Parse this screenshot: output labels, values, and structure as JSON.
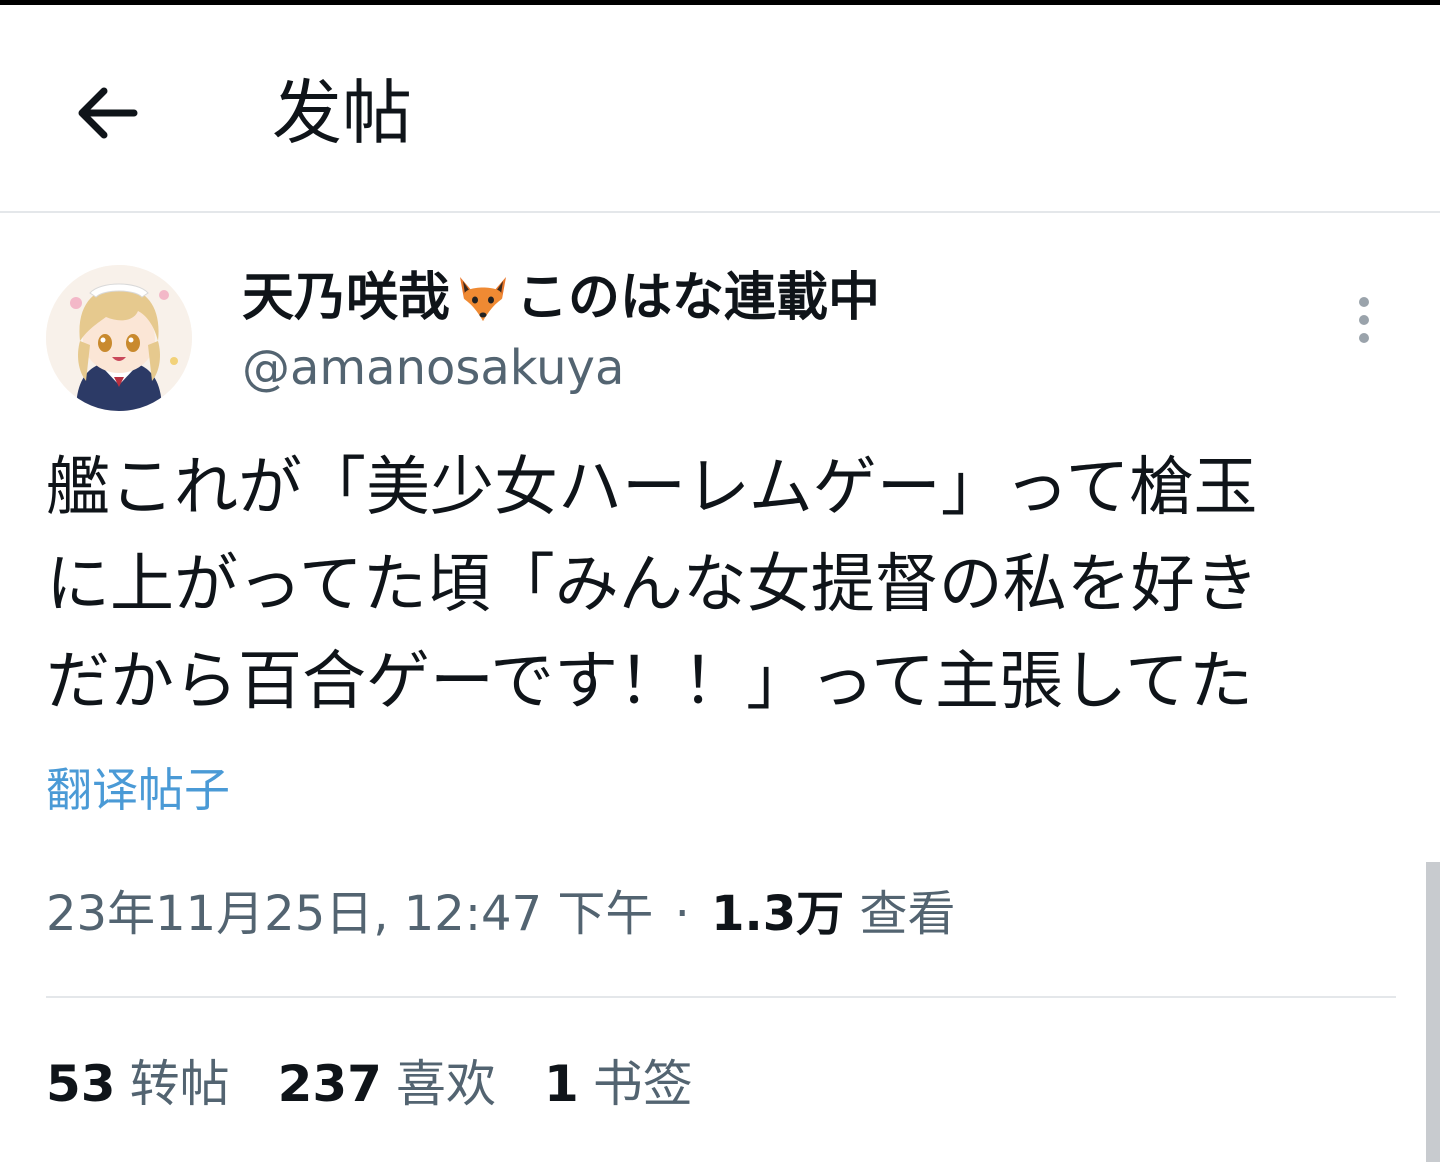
{
  "header": {
    "title": "发帖",
    "back_icon": "arrow-left-icon"
  },
  "author": {
    "name_part1": "天乃咲哉",
    "emoji": "fox-icon",
    "name_part2": "このはな連載中",
    "handle": "@amanosakuya"
  },
  "tweet": {
    "lines": [
      "艦これが「美少女ハーレムゲー」って槍玉",
      "に上がってた頃「みんな女提督の私を好き",
      "だから百合ゲーです！！」って主張してた"
    ]
  },
  "translate_label": "翻译帖子",
  "meta": {
    "timestamp": "23年11月25日, 12:47 下午",
    "separator": "·",
    "views_count": "1.3万",
    "views_label": "查看"
  },
  "stats": {
    "reposts_count": "53",
    "reposts_label": "转帖",
    "likes_count": "237",
    "likes_label": "喜欢",
    "bookmarks_count": "1",
    "bookmarks_label": "书签"
  },
  "colors": {
    "link": "#4a9ad6",
    "secondary_text": "#536471",
    "primary_text": "#0f1419"
  }
}
